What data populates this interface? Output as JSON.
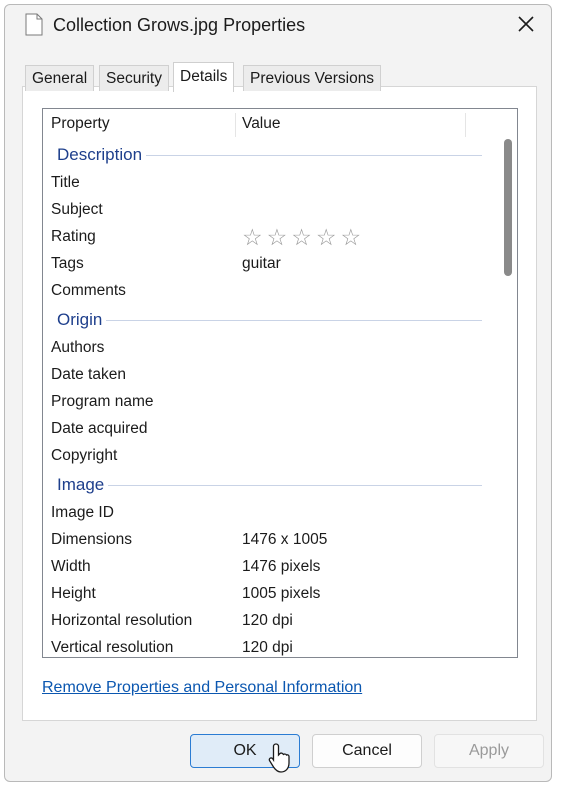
{
  "window": {
    "title": "Collection Grows.jpg Properties",
    "icon": "file-icon",
    "close_icon": "close-icon"
  },
  "tabs": [
    {
      "label": "General",
      "active": false
    },
    {
      "label": "Security",
      "active": false
    },
    {
      "label": "Details",
      "active": true
    },
    {
      "label": "Previous Versions",
      "active": false
    }
  ],
  "grid": {
    "columns": [
      "Property",
      "Value"
    ],
    "groups": [
      {
        "label": "Description",
        "rows": [
          {
            "name": "Title",
            "value": ""
          },
          {
            "name": "Subject",
            "value": ""
          },
          {
            "name": "Rating",
            "value": "",
            "stars": 0,
            "stars_max": 5
          },
          {
            "name": "Tags",
            "value": "guitar"
          },
          {
            "name": "Comments",
            "value": ""
          }
        ]
      },
      {
        "label": "Origin",
        "rows": [
          {
            "name": "Authors",
            "value": ""
          },
          {
            "name": "Date taken",
            "value": ""
          },
          {
            "name": "Program name",
            "value": ""
          },
          {
            "name": "Date acquired",
            "value": ""
          },
          {
            "name": "Copyright",
            "value": ""
          }
        ]
      },
      {
        "label": "Image",
        "rows": [
          {
            "name": "Image ID",
            "value": ""
          },
          {
            "name": "Dimensions",
            "value": "1476 x 1005"
          },
          {
            "name": "Width",
            "value": "1476 pixels"
          },
          {
            "name": "Height",
            "value": "1005 pixels"
          },
          {
            "name": "Horizontal resolution",
            "value": "120 dpi"
          },
          {
            "name": "Vertical resolution",
            "value": "120 dpi"
          }
        ]
      }
    ]
  },
  "link": {
    "label": "Remove Properties and Personal Information"
  },
  "buttons": {
    "ok": "OK",
    "cancel": "Cancel",
    "apply": "Apply"
  },
  "colors": {
    "group_header": "#1e3f8c",
    "link": "#0b57b0",
    "ok_border": "#2b7cd3"
  }
}
